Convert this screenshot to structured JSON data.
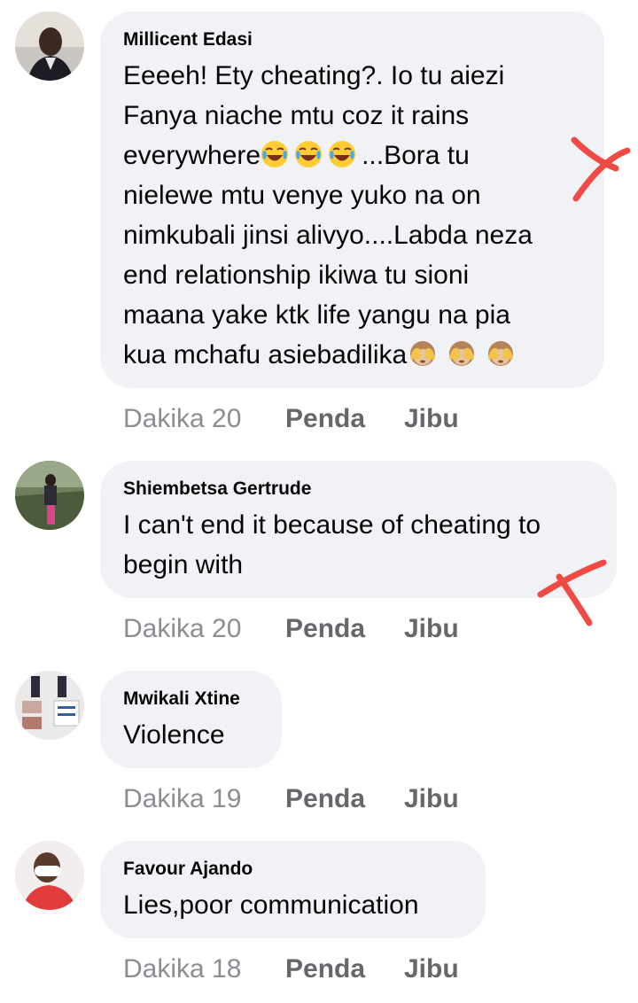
{
  "comments": [
    {
      "name": "Millicent Edasi",
      "lines": [
        "Eeeeh! Ety cheating?. Io tu aiezi",
        "Fanya niache mtu coz it rains",
        "everywhere",
        "...Bora tu",
        "nielewe mtu venye yuko na on",
        "nimkubali jinsi alivyo....Labda neza",
        "end relationship ikiwa tu sioni",
        "maana yake ktk life yangu na pia",
        "kua mchafu asiebadilika"
      ],
      "emoji_after_everywhere": [
        "joy-emoji",
        "joy-emoji",
        "joy-emoji"
      ],
      "emoji_end": [
        "see-no-evil-emoji",
        "see-no-evil-emoji",
        "see-no-evil-emoji"
      ],
      "time": "Dakika 20",
      "like": "Penda",
      "reply": "Jibu"
    },
    {
      "name": "Shiembetsa Gertrude",
      "lines": [
        "I can't end it because of cheating to",
        "begin with"
      ],
      "time": "Dakika 20",
      "like": "Penda",
      "reply": "Jibu"
    },
    {
      "name": "Mwikali Xtine",
      "lines": [
        "Violence"
      ],
      "time": "Dakika 19",
      "like": "Penda",
      "reply": "Jibu"
    },
    {
      "name": "Favour Ajando",
      "lines": [
        "Lies,poor communication"
      ],
      "time": "Dakika 18",
      "like": "Penda",
      "reply": "Jibu"
    }
  ],
  "colors": {
    "bubble": "#f0f2f5",
    "meta": "#65676b",
    "annotation": "#f04a45"
  },
  "icons": [
    "red-x-mark-icon"
  ]
}
